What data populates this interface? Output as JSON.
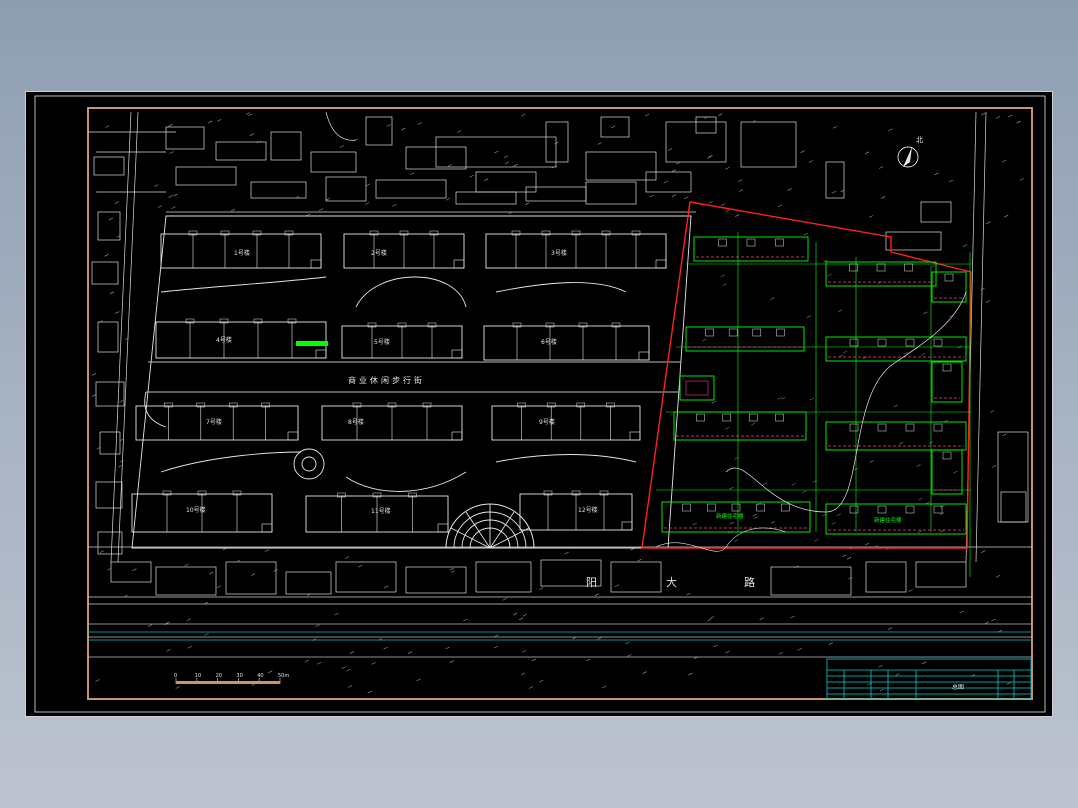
{
  "colors": {
    "background": "#000000",
    "frame": "#c8956a",
    "linework": "#e6e6e6",
    "site_boundary": "#ff2020",
    "new_buildings": "#00ff00",
    "dimension": "#ff3c8c",
    "title_block": "#00d0d0",
    "highlight": "#00ff00"
  },
  "north_label": "北",
  "road_labels": [
    "阳",
    "大",
    "路"
  ],
  "street_label": "商业休闲步行街",
  "buildings": [
    {
      "label": "1号楼"
    },
    {
      "label": "2号楼"
    },
    {
      "label": "3号楼"
    },
    {
      "label": "4号楼"
    },
    {
      "label": "5号楼"
    },
    {
      "label": "6号楼"
    },
    {
      "label": "7号楼"
    },
    {
      "label": "8号楼"
    },
    {
      "label": "9号楼"
    },
    {
      "label": "10号楼"
    },
    {
      "label": "11号楼"
    },
    {
      "label": "12号楼"
    }
  ],
  "new_site_labels": [
    "新建住宅楼",
    "新建住宅楼"
  ],
  "scale_bar": {
    "ticks": [
      "0",
      "10",
      "20",
      "30",
      "40",
      "50m"
    ]
  },
  "title_block": {
    "drawing_name": "总图"
  }
}
